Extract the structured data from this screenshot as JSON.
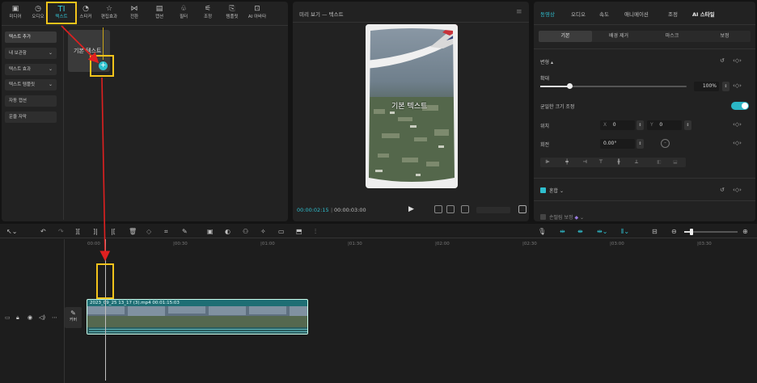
{
  "toolbar": {
    "tabs": [
      {
        "label": "미디어",
        "icon": "media-icon"
      },
      {
        "label": "오디오",
        "icon": "audio-icon"
      },
      {
        "label": "텍스트",
        "icon": "text-icon",
        "active": true
      },
      {
        "label": "스티커",
        "icon": "sticker-icon"
      },
      {
        "label": "편집효과",
        "icon": "effects-icon"
      },
      {
        "label": "전환",
        "icon": "transition-icon"
      },
      {
        "label": "캡션",
        "icon": "caption-icon"
      },
      {
        "label": "필터",
        "icon": "filter-icon"
      },
      {
        "label": "조정",
        "icon": "adjust-icon"
      },
      {
        "label": "템플릿",
        "icon": "template-icon"
      },
      {
        "label": "AI 아바타",
        "icon": "ai-avatar-icon"
      }
    ]
  },
  "sidebar": {
    "items": [
      {
        "label": "텍스트 추가"
      },
      {
        "label": "내 보관함"
      },
      {
        "label": "텍스트 효과"
      },
      {
        "label": "텍스트 템플릿"
      },
      {
        "label": "자동 캡션"
      },
      {
        "label": "운율 자막"
      }
    ]
  },
  "text_tile": {
    "label": "기본 텍스트"
  },
  "preview": {
    "title": "미리 보기 — 텍스트",
    "overlay_text": "기본 텍스트",
    "time_current": "00:00:02:15",
    "time_total": "00:00:03:00"
  },
  "properties": {
    "tabs": [
      "동영상",
      "오디오",
      "속도",
      "애니메이션",
      "조정",
      "AI 스타일"
    ],
    "subtabs": [
      "기본",
      "배경 제거",
      "마스크",
      "보정"
    ],
    "transform_label": "변형",
    "scale_label": "확대",
    "scale_value": "100%",
    "scale_level": 0.2,
    "uniform_scale_label": "균일한 크기 조정",
    "position_label": "위치",
    "pos_x_label": "X",
    "pos_x_value": "0",
    "pos_y_label": "Y",
    "pos_y_value": "0",
    "rotate_label": "회전",
    "rotate_value": "0.00°",
    "blend_label": "혼합",
    "stabilize_label": "손떨림 보정"
  },
  "timeline": {
    "ruler_labels": [
      "00:00",
      "|00:30",
      "|01:00",
      "|01:30",
      "|02:00",
      "|02:30",
      "|03:00",
      "|03:30"
    ],
    "clip_label": "2023_09_25 13_17 (3).mp4   00:01:15:03",
    "cover_label": "커버"
  },
  "colors": {
    "accent": "#2fbfcf",
    "highlight": "#f3c31b",
    "arrow": "#e02020",
    "clip": "#1e6e74"
  }
}
